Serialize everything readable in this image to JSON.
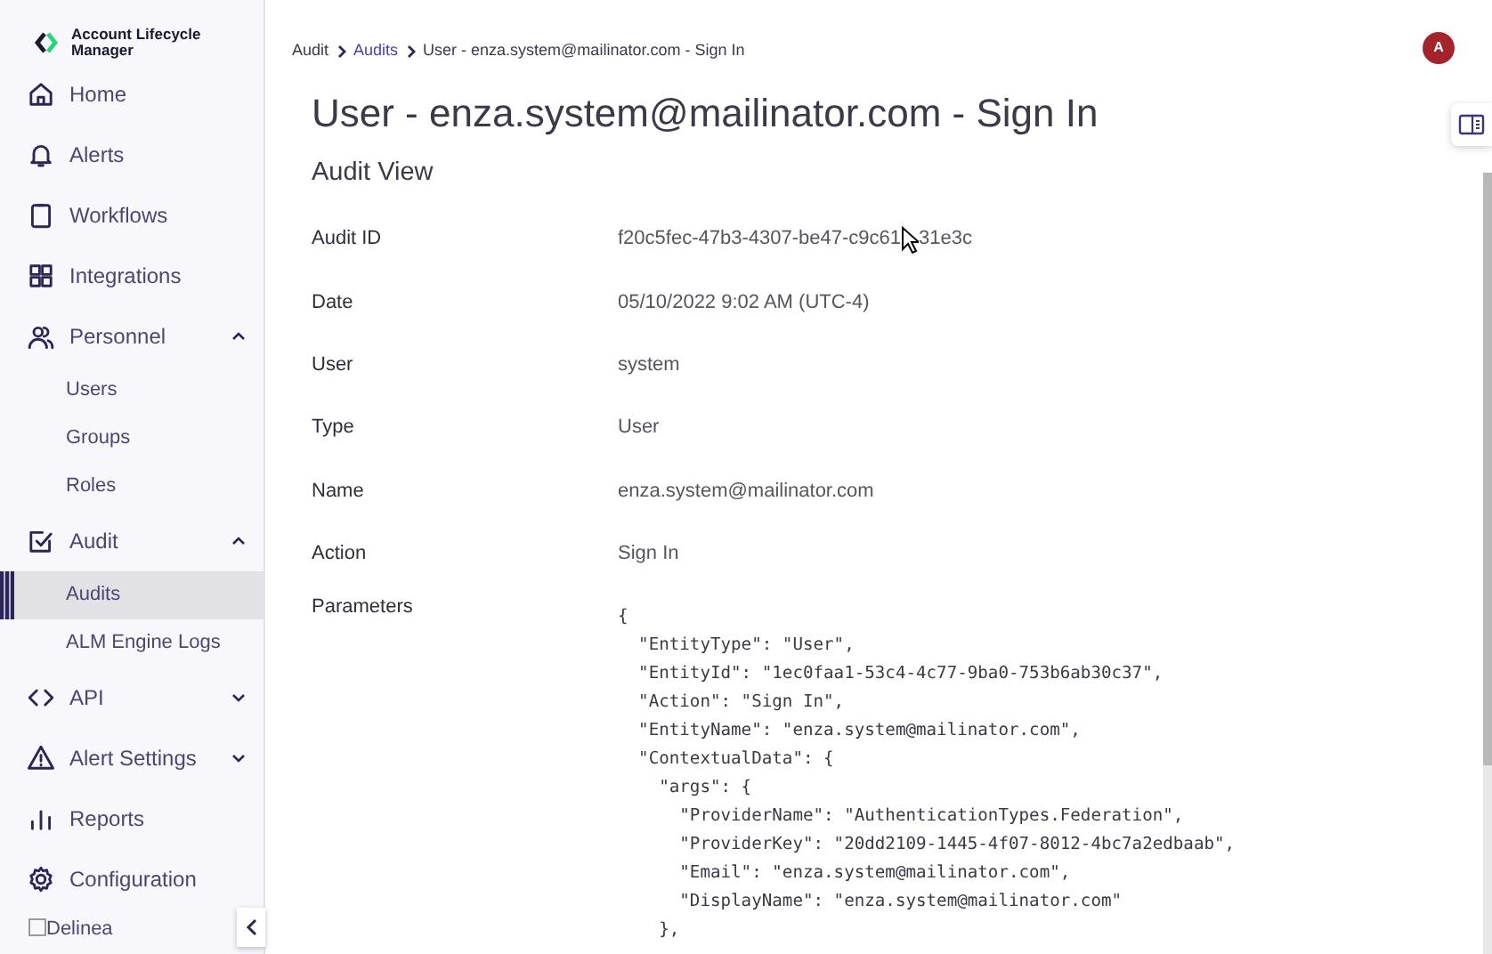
{
  "app_name": "Account Lifecycle Manager",
  "nav": [
    {
      "label": "Home"
    },
    {
      "label": "Alerts"
    },
    {
      "label": "Workflows"
    },
    {
      "label": "Integrations"
    },
    {
      "label": "Personnel",
      "expanded": true,
      "children": [
        {
          "label": "Users",
          "selected": false
        },
        {
          "label": "Groups",
          "selected": false
        },
        {
          "label": "Roles",
          "selected": false
        }
      ]
    },
    {
      "label": "Audit",
      "expanded": true,
      "children": [
        {
          "label": "Audits",
          "selected": true
        },
        {
          "label": "ALM Engine Logs",
          "selected": false
        }
      ]
    },
    {
      "label": "API",
      "expanded": false
    },
    {
      "label": "Alert Settings",
      "expanded": false
    },
    {
      "label": "Reports"
    },
    {
      "label": "Configuration"
    }
  ],
  "footer_logo": "Delinea",
  "breadcrumb": [
    {
      "label": "Audit",
      "link": false
    },
    {
      "label": "Audits",
      "link": true
    },
    {
      "label": "User - enza.system@mailinator.com - Sign In",
      "link": false
    }
  ],
  "avatar": "A",
  "title": "User - enza.system@mailinator.com - Sign In",
  "section": "Audit View",
  "fields": [
    {
      "label": "Audit ID",
      "value": "f20c5fec-47b3-4307-be47-c9c61",
      "value_end": "31e3c"
    },
    {
      "label": "Date",
      "value": "05/10/2022 9:02 AM (UTC-4)"
    },
    {
      "label": "User",
      "value": "system"
    },
    {
      "label": "Type",
      "value": "User"
    },
    {
      "label": "Name",
      "value": "enza.system@mailinator.com"
    },
    {
      "label": "Action",
      "value": "Sign In"
    }
  ],
  "parameters": {
    "label": "Parameters",
    "lines": [
      "{",
      "  \"EntityType\": \"User\",",
      "  \"EntityId\": \"1ec0faa1-53c4-4c77-9ba0-753b6ab30c37\",",
      "  \"Action\": \"Sign In\",",
      "  \"EntityName\": \"enza.system@mailinator.com\",",
      "  \"ContextualData\": {",
      "    \"args\": {",
      "      \"ProviderName\": \"AuthenticationTypes.Federation\",",
      "      \"ProviderKey\": \"20dd2109-1445-4f07-8012-4bc7a2edbaab\",",
      "      \"Email\": \"enza.system@mailinator.com\",",
      "      \"DisplayName\": \"enza.system@mailinator.com\"",
      "    },"
    ]
  }
}
